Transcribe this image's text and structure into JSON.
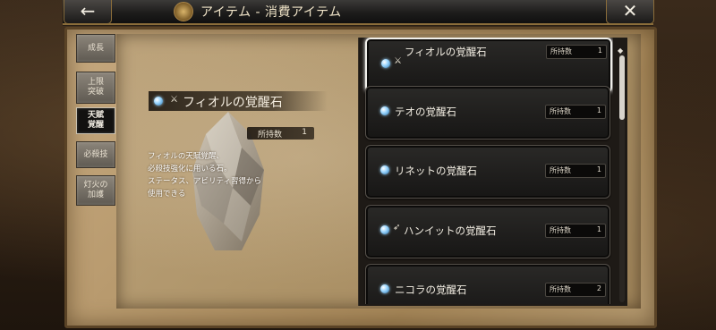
{
  "header": {
    "back_symbol": "←",
    "title": "アイテム - 消費アイテム",
    "close_symbol": "✕"
  },
  "tabs": [
    {
      "line1": "成長",
      "line2": "",
      "active": false
    },
    {
      "line1": "上限",
      "line2": "突破",
      "active": false
    },
    {
      "line1": "天賦",
      "line2": "覚醒",
      "active": true
    },
    {
      "line1": "必殺技",
      "line2": "",
      "active": false
    },
    {
      "line1": "灯火の",
      "line2": "加護",
      "active": false
    }
  ],
  "detail": {
    "title": "フィオルの覚醒石",
    "count_label": "所持数",
    "count_value": "1",
    "description": [
      "フィオルの天賦覚醒、",
      "必殺技強化に用いる石。",
      "ステータス、アビリティ習得から",
      "使用できる"
    ]
  },
  "items": [
    {
      "name": "フィオルの覚醒石",
      "has_sword": true,
      "count_label": "所持数",
      "count": "1",
      "selected": true
    },
    {
      "name": "テオの覚醒石",
      "has_sword": false,
      "count_label": "所持数",
      "count": "1",
      "selected": false
    },
    {
      "name": "リネットの覚醒石",
      "has_sword": false,
      "count_label": "所持数",
      "count": "1",
      "selected": false
    },
    {
      "name": "ハンイットの覚醒石",
      "has_sword": false,
      "has_bow": true,
      "count_label": "所持数",
      "count": "1",
      "selected": false
    },
    {
      "name": "ニコラの覚醒石",
      "has_sword": false,
      "count_label": "所持数",
      "count": "2",
      "selected": false
    }
  ],
  "colors": {
    "gem": "#9fd8ff",
    "frame": "#5a4326",
    "card": "#1e1d1b"
  }
}
